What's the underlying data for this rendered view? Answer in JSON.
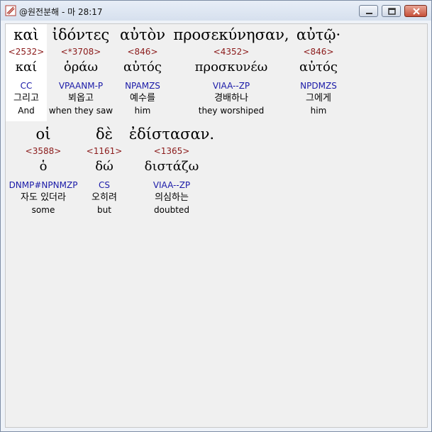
{
  "window": {
    "title": "@원전분해 - 마 28:17"
  },
  "rows": [
    {
      "words": [
        {
          "greek": "καὶ",
          "strong": "<2532>",
          "lemma": "καί",
          "morph": "CC",
          "korean": "그리고",
          "english": "And"
        },
        {
          "greek": "ἰδόντες",
          "strong": "<*3708>",
          "lemma": "ὁράω",
          "morph": "VPAANM-P",
          "korean": "뵈옵고",
          "english": "when they saw"
        },
        {
          "greek": "αὐτὸν",
          "strong": "<846>",
          "lemma": "αὐτός",
          "morph": "NPAMZS",
          "korean": "예수를",
          "english": "him"
        },
        {
          "greek": "προσεκύνησαν,",
          "strong": "<4352>",
          "lemma": "προσκυνέω",
          "morph": "VIAA--ZP",
          "korean": "경배하나",
          "english": "they worshiped"
        },
        {
          "greek": "αὐτῷ·",
          "strong": "<846>",
          "lemma": "αὐτός",
          "morph": "NPDMZS",
          "korean": "그에게",
          "english": "him"
        }
      ]
    },
    {
      "words": [
        {
          "greek": "οἱ",
          "strong": "<3588>",
          "lemma": "ὁ",
          "morph": "DNMP#NPNMZP",
          "korean": "자도 있더라",
          "english": "some"
        },
        {
          "greek": "δὲ",
          "strong": "<1161>",
          "lemma": "δώ",
          "morph": "CS",
          "korean": "오히려",
          "english": "but"
        },
        {
          "greek": "ἐδίστασαν.",
          "strong": "<1365>",
          "lemma": "διστάζω",
          "morph": "VIAA--ZP",
          "korean": "의심하는",
          "english": "doubted"
        }
      ]
    }
  ]
}
